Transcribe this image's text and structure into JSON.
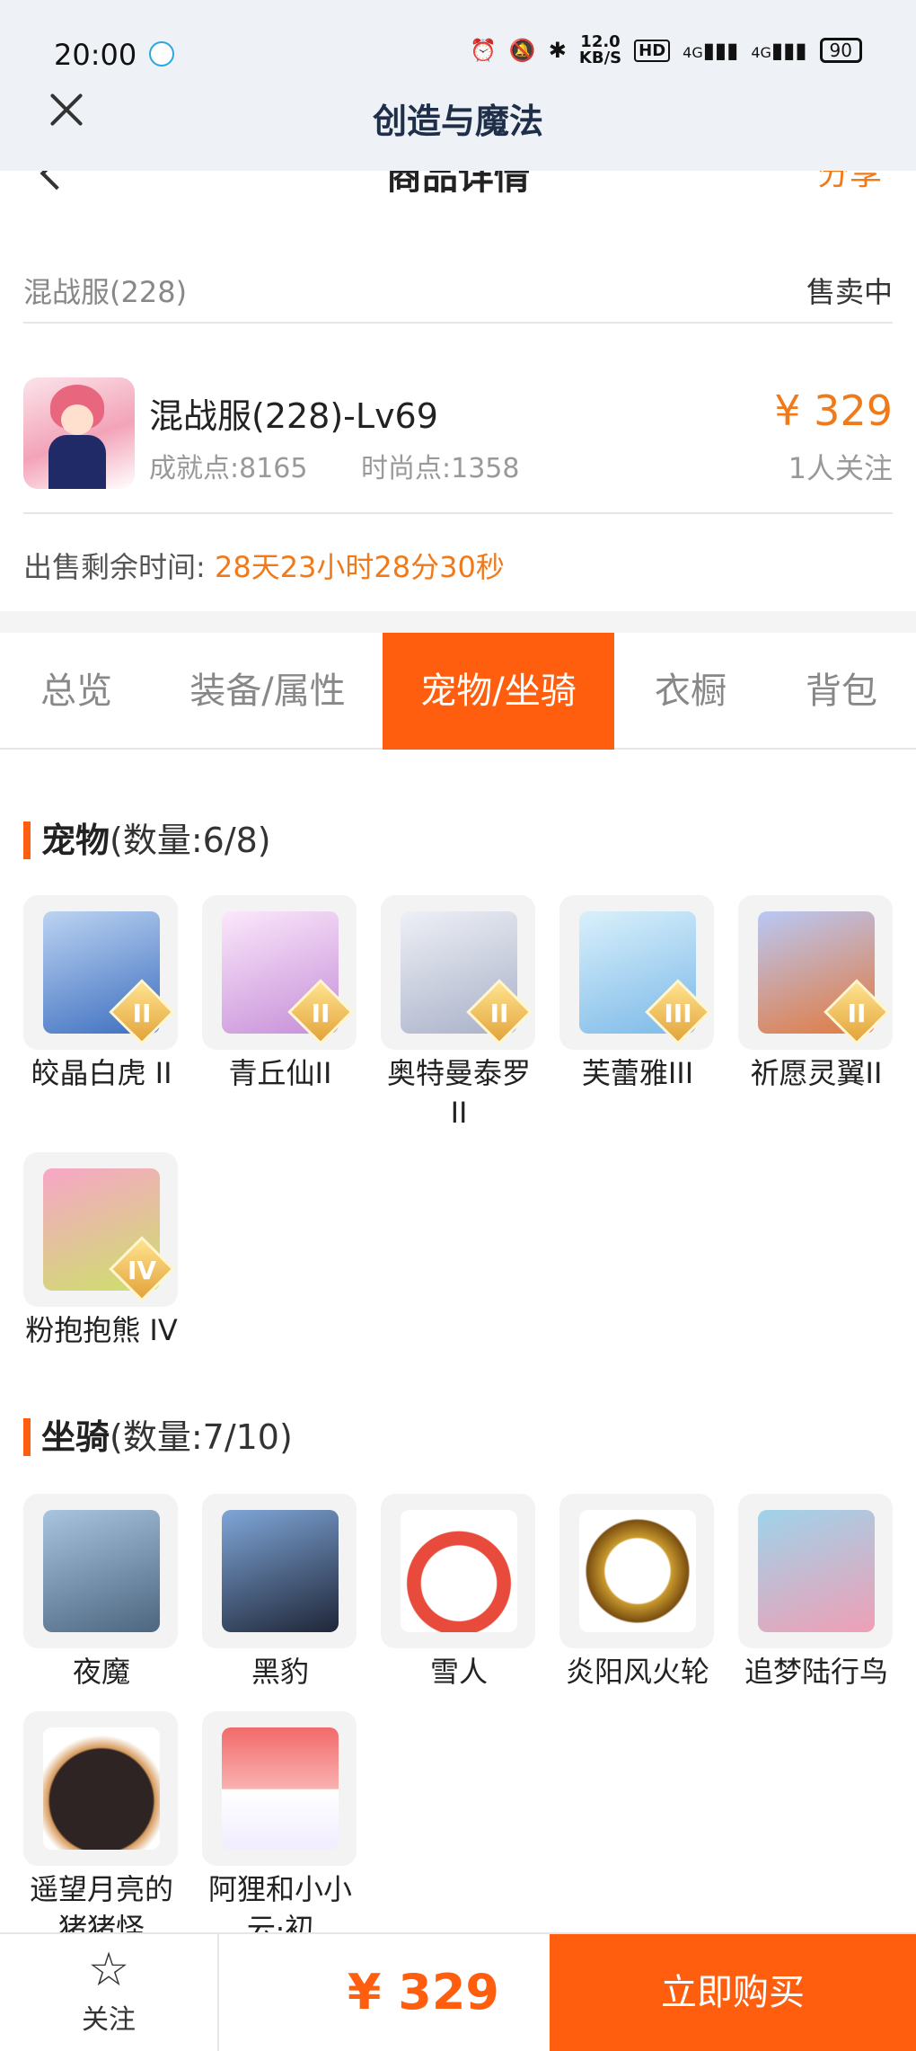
{
  "status_bar": {
    "time": "20:00",
    "net_speed": "12.0\nKB/S",
    "net_hd": "HD",
    "sim1": "4G",
    "sim2": "4G",
    "battery": "90"
  },
  "app_header": {
    "title": "创造与魔法"
  },
  "page_header": {
    "title": "商品详情",
    "share": "分享"
  },
  "listing": {
    "server": "混战服(228)",
    "status": "售卖中",
    "name": "混战服(228)-Lv69",
    "achievement": "成就点:8165",
    "fashion": "时尚点:1358",
    "price": "¥ 329",
    "followers": "1人关注",
    "remaining_label": "出售剩余时间:",
    "remaining_value": "28天23小时28分30秒"
  },
  "tabs": [
    {
      "label": "总览"
    },
    {
      "label": "装备/属性"
    },
    {
      "label": "宠物/坐骑"
    },
    {
      "label": "衣橱"
    },
    {
      "label": "背包"
    }
  ],
  "pets": {
    "label": "宠物",
    "count": "(数量:6/8)",
    "items": [
      {
        "name": "皎晶白虎 II",
        "badge": "II",
        "color": "#6f9fe0"
      },
      {
        "name": "青丘仙II",
        "badge": "II",
        "color": "#e7b3e8"
      },
      {
        "name": "奥特曼泰罗II",
        "badge": "II",
        "color": "#d9dce8"
      },
      {
        "name": "芙蕾雅III",
        "badge": "III",
        "color": "#9bd0f0"
      },
      {
        "name": "祈愿灵翼II",
        "badge": "II",
        "color": "#e58b5a"
      },
      {
        "name": "粉抱抱熊 IV",
        "badge": "IV",
        "color": "#f28bb8"
      }
    ]
  },
  "mounts": {
    "label": "坐骑",
    "count": "(数量:7/10)",
    "items": [
      {
        "name": "夜魔",
        "color": "#6a89a8"
      },
      {
        "name": "黑豹",
        "color": "#2e3a55"
      },
      {
        "name": "雪人",
        "color": "#f2f2f2"
      },
      {
        "name": "炎阳风火轮",
        "color": "#c99a2e"
      },
      {
        "name": "追梦陆行鸟",
        "color": "#e9a0b4"
      },
      {
        "name": "遥望月亮的猪猪怪",
        "color": "#3a2d2d"
      },
      {
        "name": "阿狸和小小云·初",
        "color": "#f29a9a"
      }
    ]
  },
  "bottom_bar": {
    "follow_label": "关注",
    "price": "¥ 329",
    "buy_label": "立即购买"
  }
}
